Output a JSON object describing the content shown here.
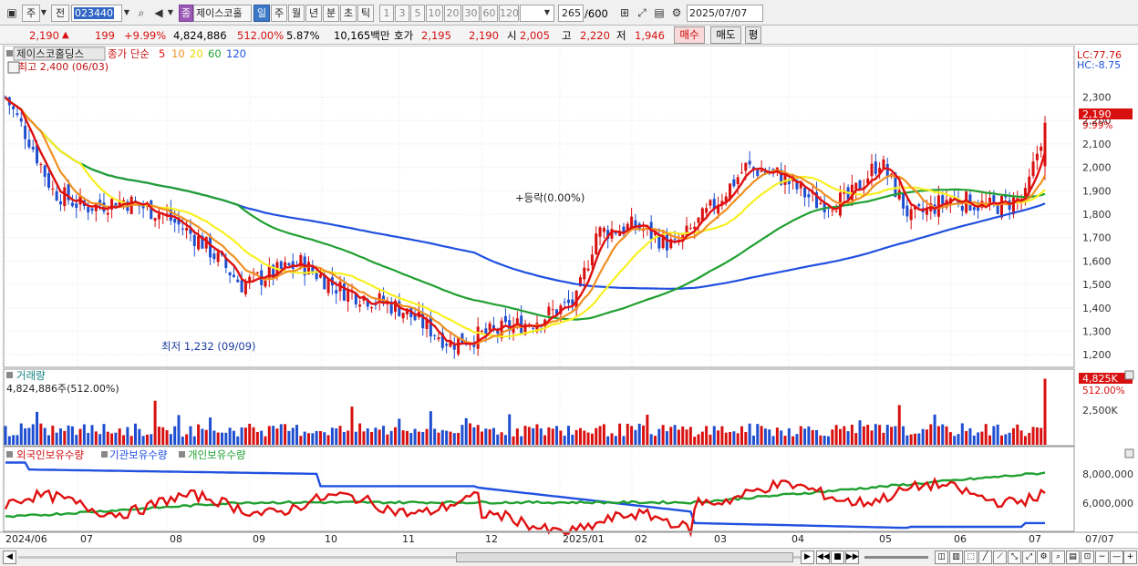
{
  "toolbar": {
    "market_label": "주",
    "prev_label": "전",
    "code_value": "023440",
    "type_badge": "종",
    "stock_name": "제이스코홀",
    "periods": [
      "일",
      "주",
      "월",
      "년",
      "분",
      "초",
      "틱"
    ],
    "selected_period": "일",
    "intervals": [
      "1",
      "3",
      "5",
      "10",
      "20",
      "30",
      "60",
      "120"
    ],
    "count_value": "265",
    "count_total": "/600",
    "date_value": "2025/07/07"
  },
  "quote": {
    "price": "2,190",
    "change": "199",
    "change_pct": "+9.99%",
    "volume": "4,824,886",
    "volume_ratio": "512.00%",
    "turnover": "5.87%",
    "amount": "10,165백만",
    "bid_label": "호가",
    "bid1": "2,195",
    "bid2": "2,190",
    "open_label": "시",
    "open": "2,005",
    "high_label": "고",
    "high": "2,220",
    "low_label": "저",
    "low": "1,946",
    "buy_label": "매수",
    "sell_label": "매도",
    "eval_label": "평"
  },
  "price_panel": {
    "stock_name": "제이스코홀딩스",
    "ma_label": "종가 단순",
    "ma_periods": [
      "5",
      "10",
      "20",
      "60",
      "120"
    ],
    "high_note": "최고 2,400 (06/03)",
    "low_note": "최저 1,232 (09/09)",
    "mid_note": "+등락(0.00%)",
    "lc": "LC:77.76",
    "hc": "HC:-8.75",
    "last_tag": "2,190",
    "last_pct": "9.99%",
    "y_ticks": [
      "2,300",
      "2,200",
      "2,100",
      "2,000",
      "1,900",
      "1,800",
      "1,700",
      "1,600",
      "1,500",
      "1,400",
      "1,300",
      "1,200"
    ]
  },
  "volume_panel": {
    "title": "거래량",
    "value_note": "4,824,886주(512.00%)",
    "tag": "4,825K",
    "tag_pct": "512.00%",
    "y_tick": "2,500K"
  },
  "holdings_panel": {
    "legend": [
      "외국인보유수량",
      "기관보유수량",
      "개인보유수량"
    ],
    "y_ticks": [
      "8,000,000",
      "6,000,000"
    ]
  },
  "x_axis": {
    "labels": [
      "2024/06",
      "07",
      "08",
      "09",
      "10",
      "11",
      "12",
      "2025/01",
      "02",
      "03",
      "04",
      "05",
      "06",
      "07"
    ],
    "right_label": "07/07"
  },
  "colors": {
    "up": "#d81010",
    "down": "#1f4fd0",
    "ma5": "#e01010",
    "ma10": "#f09020",
    "ma20": "#f8f020",
    "ma60": "#20a030",
    "ma120": "#2050e0",
    "foreign": "#e01010",
    "institution": "#2050e0",
    "individual": "#20a030"
  }
}
